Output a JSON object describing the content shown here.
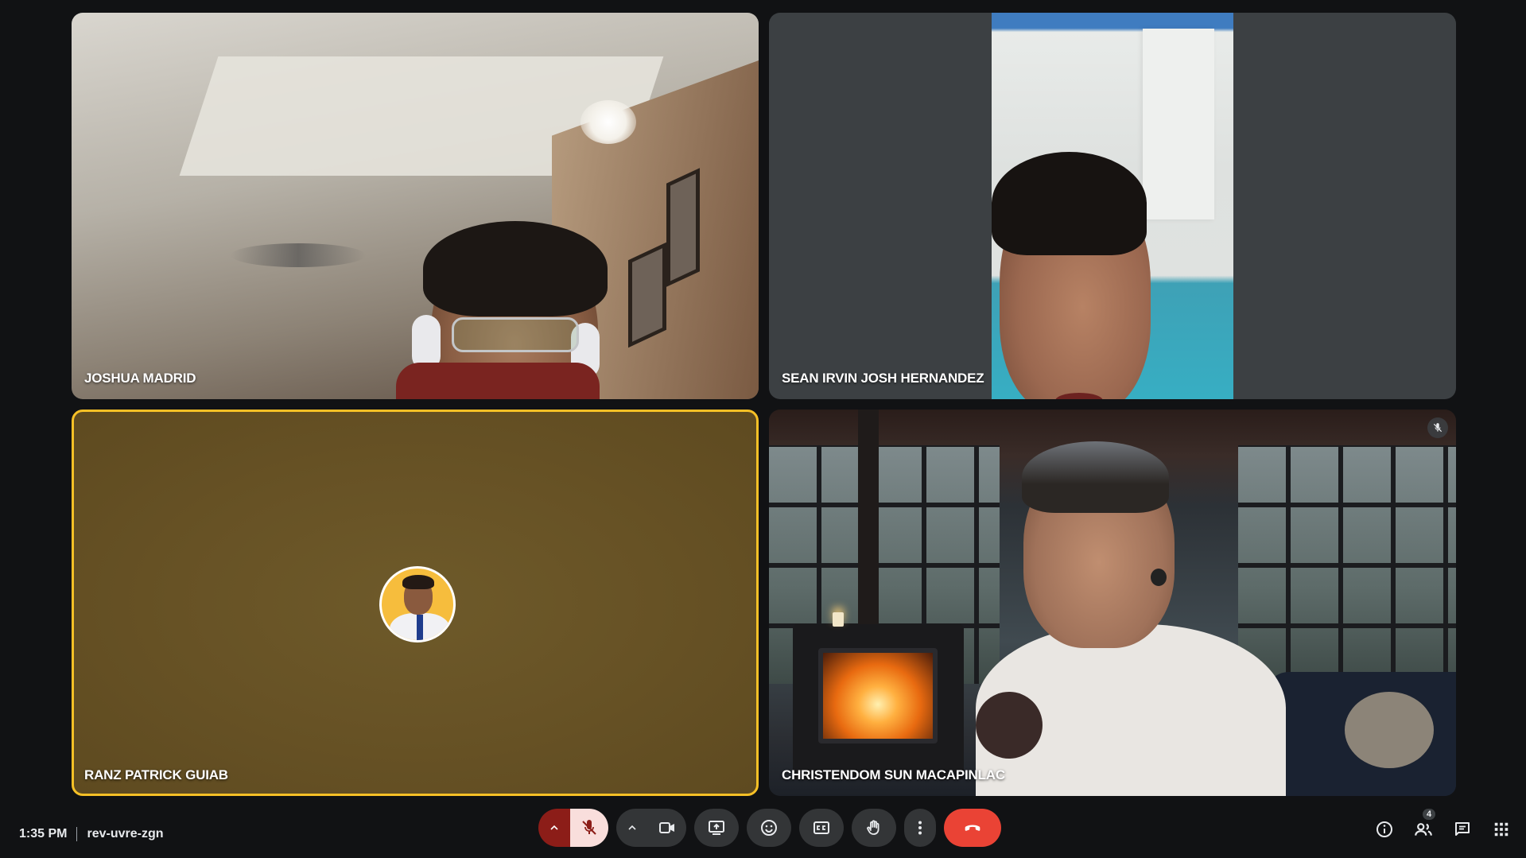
{
  "participants": [
    {
      "name": "JOSHUA MADRID"
    },
    {
      "name": "SEAN IRVIN JOSH HERNANDEZ"
    },
    {
      "name": "RANZ PATRICK GUIAB"
    },
    {
      "name": "CHRISTENDOM SUN MACAPINLAC"
    }
  ],
  "meeting": {
    "time": "1:35 PM",
    "code": "rev-uvre-zgn",
    "participant_count": "4"
  },
  "colors": {
    "background": "#111214",
    "active_speaker_border": "#f6c026",
    "end_call": "#ea4335",
    "mic_muted_bg": "#f9dedc",
    "mic_muted_left": "#8c1d18"
  },
  "icons": {
    "mic_options": "chevron-up-icon",
    "mic": "mic-off-icon",
    "camera_options": "chevron-up-icon",
    "camera": "videocam-icon",
    "present": "present-screen-icon",
    "emoji": "emoji-icon",
    "captions": "captions-icon",
    "raise_hand": "hand-icon",
    "more": "more-vert-icon",
    "end_call": "call-end-icon",
    "info": "info-icon",
    "people": "people-icon",
    "chat": "chat-icon",
    "activities": "apps-grid-icon"
  }
}
